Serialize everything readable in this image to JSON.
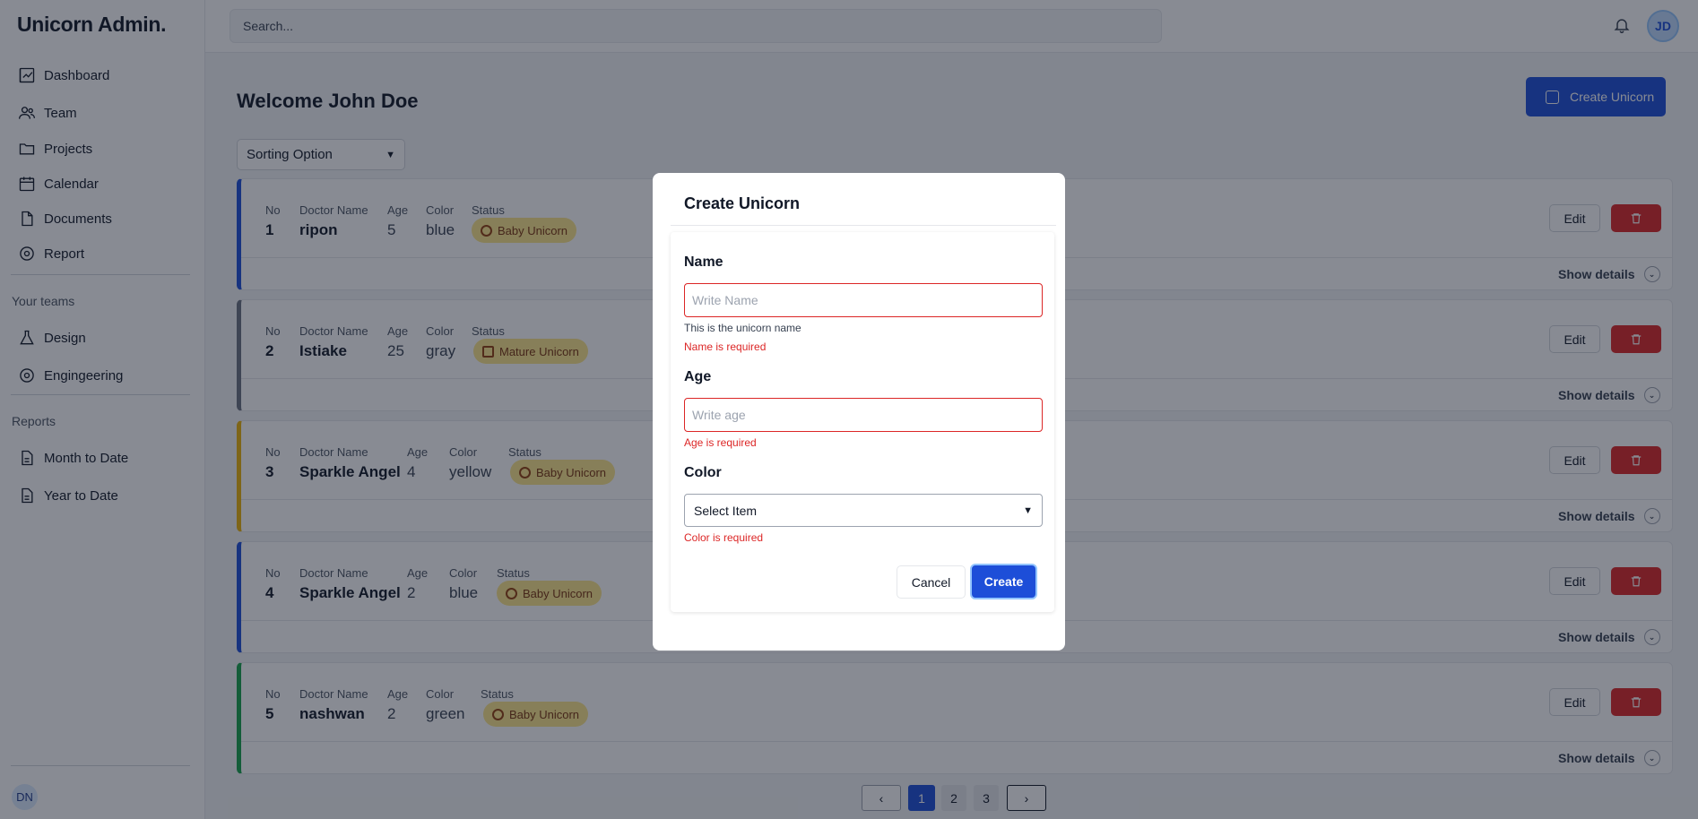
{
  "app": {
    "title": "Unicorn Admin."
  },
  "sidebar": {
    "items": [
      {
        "label": "Dashboard",
        "icon": "chart-icon"
      },
      {
        "label": "Team",
        "icon": "users-icon"
      },
      {
        "label": "Projects",
        "icon": "folder-icon"
      },
      {
        "label": "Calendar",
        "icon": "calendar-icon"
      },
      {
        "label": "Documents",
        "icon": "document-icon"
      },
      {
        "label": "Report",
        "icon": "gear-icon"
      }
    ],
    "teams_title": "Your teams",
    "teams": [
      {
        "label": "Design",
        "icon": "flask-icon"
      },
      {
        "label": "Engingeering",
        "icon": "gear-icon"
      }
    ],
    "reports_title": "Reports",
    "reports": [
      {
        "label": "Month to Date",
        "icon": "document-icon"
      },
      {
        "label": "Year to Date",
        "icon": "document-icon"
      }
    ],
    "user_initials": "DN"
  },
  "header": {
    "search_placeholder": "Search...",
    "avatar_initials": "JD"
  },
  "main": {
    "welcome": "Welcome John Doe",
    "create_button": "Create Unicorn",
    "sort_label": "Sorting Option",
    "headers": {
      "no": "No",
      "name": "Doctor Name",
      "age": "Age",
      "color": "Color",
      "status": "Status"
    },
    "edit_label": "Edit",
    "show_details": "Show details",
    "rows": [
      {
        "no": "1",
        "name": "ripon",
        "age": "5",
        "color": "blue",
        "status": "Baby Unicorn",
        "accent": "#1d4ed8"
      },
      {
        "no": "2",
        "name": "Istiake",
        "age": "25",
        "color": "gray",
        "status": "Mature Unicorn",
        "accent": "#6b7280"
      },
      {
        "no": "3",
        "name": "Sparkle Angel",
        "age": "4",
        "color": "yellow",
        "status": "Baby Unicorn",
        "accent": "#eab308"
      },
      {
        "no": "4",
        "name": "Sparkle Angel",
        "age": "2",
        "color": "blue",
        "status": "Baby Unicorn",
        "accent": "#1d4ed8"
      },
      {
        "no": "5",
        "name": "nashwan",
        "age": "2",
        "color": "green",
        "status": "Baby Unicorn",
        "accent": "#16a34a"
      }
    ],
    "pagination": {
      "pages": [
        "1",
        "2",
        "3"
      ],
      "current": "1"
    }
  },
  "modal": {
    "title": "Create Unicorn",
    "name_label": "Name",
    "name_placeholder": "Write Name",
    "name_hint": "This is the unicorn name",
    "name_error": "Name is required",
    "age_label": "Age",
    "age_placeholder": "Write age",
    "age_error": "Age is required",
    "color_label": "Color",
    "color_select": "Select Item",
    "color_error": "Color is required",
    "cancel": "Cancel",
    "create": "Create"
  }
}
